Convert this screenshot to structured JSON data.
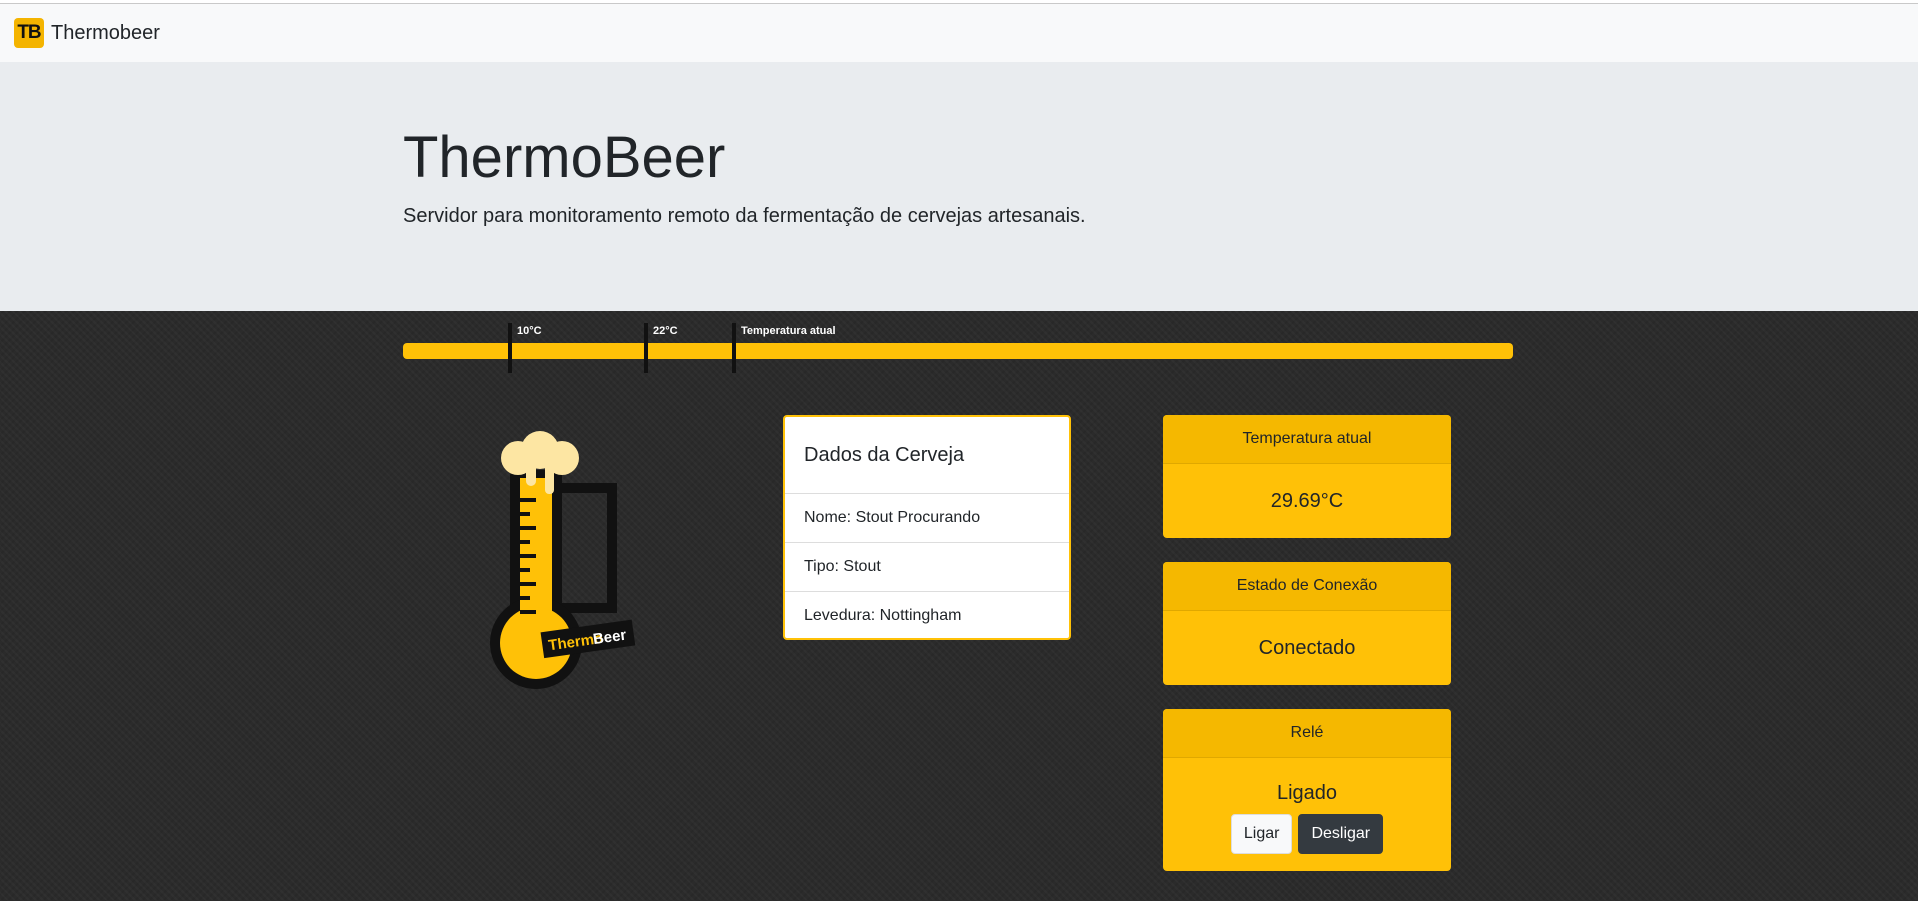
{
  "navbar": {
    "logo_text": "TB",
    "brand": "Thermobeer"
  },
  "jumbotron": {
    "title": "ThermoBeer",
    "lead": "Servidor para monitoramento remoto da fermentação de cervejas artesanais."
  },
  "temperature_bar": {
    "markers": [
      {
        "label": "10°C"
      },
      {
        "label": "22°C"
      },
      {
        "label": "Temperatura atual"
      }
    ]
  },
  "logo": {
    "text_thermo": "Thermo",
    "text_beer": "Beer"
  },
  "beer_card": {
    "title": "Dados da Cerveja",
    "rows": [
      "Nome: Stout Procurando",
      "Tipo: Stout",
      "Levedura: Nottingham"
    ]
  },
  "status": {
    "temperature": {
      "title": "Temperatura atual",
      "value": "29.69°C"
    },
    "connection": {
      "title": "Estado de Conexão",
      "value": "Conectado"
    },
    "relay": {
      "title": "Relé",
      "value": "Ligado",
      "on_label": "Ligar",
      "off_label": "Desligar"
    }
  },
  "colors": {
    "accent": "#ffc107",
    "dark_bg": "#2b2b2b",
    "jumbotron": "#e9ecef"
  }
}
